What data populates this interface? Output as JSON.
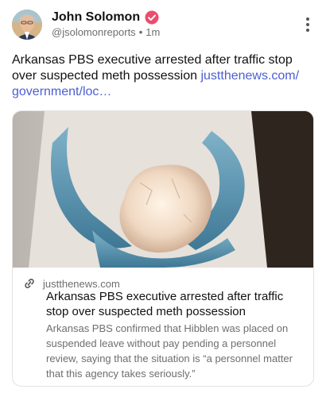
{
  "author": {
    "name": "John Solomon",
    "handle": "@jsolomonreports",
    "separator": "•",
    "time": "1m"
  },
  "post": {
    "text": "Arkansas PBS executive arrested after traffic stop over suspected meth possession",
    "link": "justthenews.com/ government/loc…"
  },
  "card": {
    "domain": "justthenews.com",
    "title": "Arkansas PBS executive arrested after traffic stop over suspected meth possession",
    "description": "Arkansas PBS confirmed that Hibblen was placed on suspended leave without pay pending a personnel review, saying that the situation is “a personnel matter that this agency takes seriously.”"
  },
  "icons": {
    "verified": "verified-badge-icon",
    "more": "more-vertical-icon",
    "link": "link-chain-icon"
  },
  "colors": {
    "accent_link": "#4b5fd1",
    "verified": "#ec4d6c",
    "muted_text": "#6e6e6e"
  }
}
